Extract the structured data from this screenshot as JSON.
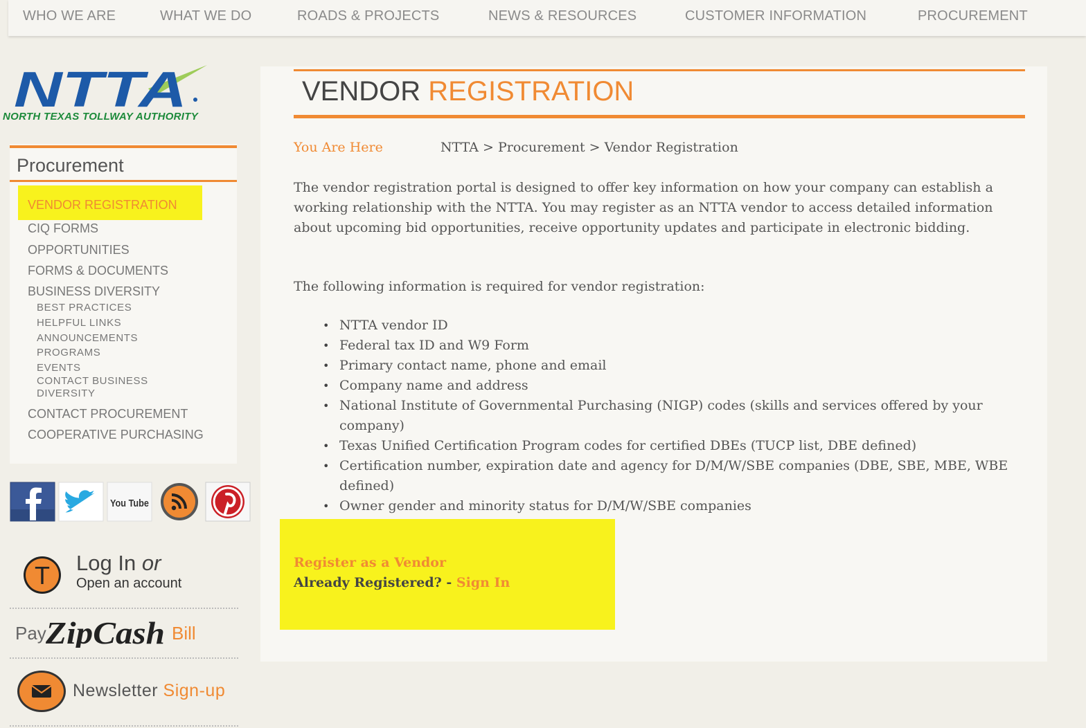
{
  "nav": {
    "items": [
      "WHO WE ARE",
      "WHAT WE DO",
      "ROADS & PROJECTS",
      "NEWS & RESOURCES",
      "CUSTOMER INFORMATION",
      "PROCUREMENT"
    ]
  },
  "logo": {
    "mark": "NTTA",
    "tagline": "NORTH TEXAS TOLLWAY AUTHORITY"
  },
  "sidebar": {
    "heading": "Procurement",
    "items": [
      {
        "label": "VENDOR REGISTRATION",
        "active": true
      },
      {
        "label": "CIQ FORMS"
      },
      {
        "label": "OPPORTUNITIES"
      },
      {
        "label": "FORMS & DOCUMENTS"
      },
      {
        "label": "BUSINESS DIVERSITY"
      }
    ],
    "subitems": [
      "BEST PRACTICES",
      "HELPFUL LINKS",
      "ANNOUNCEMENTS",
      "PROGRAMS",
      "EVENTS",
      "CONTACT BUSINESS",
      "DIVERSITY"
    ],
    "bottom_items": [
      "CONTACT PROCUREMENT",
      "COOPERATIVE PURCHASING"
    ]
  },
  "social": {
    "icons": [
      "facebook-icon",
      "twitter-icon",
      "youtube-icon",
      "rss-icon",
      "pinterest-icon"
    ],
    "youtube_text": "You Tube"
  },
  "account": {
    "icon_letter": "T",
    "login": "Log In",
    "or": "or",
    "open": "Open an account"
  },
  "pay": {
    "pay": "Pay",
    "brand": "ZipCash",
    "bill": "Bill"
  },
  "newsletter": {
    "label": "Newsletter",
    "action": "Sign-up"
  },
  "main": {
    "title_part1": "VENDOR",
    "title_part2": "REGISTRATION",
    "you_are_here": "You Are Here",
    "breadcrumb": "NTTA > Procurement > Vendor Registration",
    "intro": "The vendor registration portal is designed to offer key information on how your company can establish a working relationship with the NTTA. You may register as an NTTA vendor to access detailed information about upcoming bid opportunities, receive opportunity updates and participate in electronic bidding.",
    "required_intro": "The following information is required for vendor registration:",
    "requirements": [
      "NTTA vendor ID",
      "Federal tax ID and W9 Form",
      "Primary contact name, phone and email",
      "Company name and address",
      "National Institute of Governmental Purchasing (NIGP) codes (skills and services offered by your company)",
      "Texas Unified Certification Program codes for certified DBEs (TUCP list, DBE defined)",
      "Certification number, expiration date and agency for D/M/W/SBE companies (DBE, SBE, MBE, WBE defined)",
      "Owner gender and minority status for D/M/W/SBE companies"
    ],
    "register_link": "Register as a Vendor",
    "already_text": "Already Registered? -",
    "sign_in": "Sign In"
  },
  "colors": {
    "accent": "#f08a33",
    "highlight": "#f8f21d",
    "ntta_blue": "#1d5aa8",
    "ntta_green": "#1c8a3a"
  }
}
